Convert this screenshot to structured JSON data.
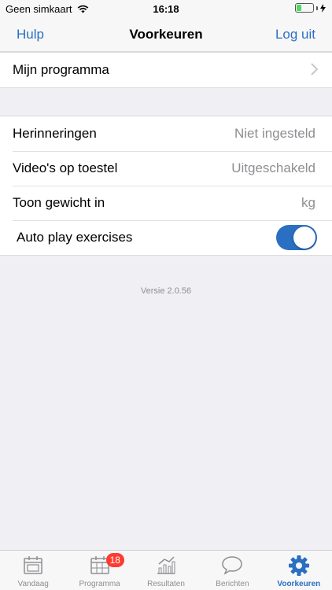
{
  "status_bar": {
    "carrier": "Geen simkaart",
    "time": "16:18"
  },
  "nav": {
    "left": "Hulp",
    "title": "Voorkeuren",
    "right": "Log uit"
  },
  "program": {
    "label": "Mijn programma"
  },
  "settings": [
    {
      "label": "Herinneringen",
      "value": "Niet ingesteld"
    },
    {
      "label": "Video's op toestel",
      "value": "Uitgeschakeld"
    },
    {
      "label": "Toon gewicht in",
      "value": "kg"
    },
    {
      "label": "Auto play exercises",
      "toggle_on": true
    }
  ],
  "version": "Versie 2.0.56",
  "tabs": [
    {
      "label": "Vandaag",
      "icon": "calendar-icon"
    },
    {
      "label": "Programma",
      "icon": "program-calendar-icon",
      "badge": "18"
    },
    {
      "label": "Resultaten",
      "icon": "chart-icon"
    },
    {
      "label": "Berichten",
      "icon": "chat-bubble-icon"
    },
    {
      "label": "Voorkeuren",
      "icon": "gear-icon",
      "active": true
    }
  ],
  "colors": {
    "accent": "#2a6fc1",
    "badge": "#ff3b30",
    "background": "#efeff4"
  }
}
